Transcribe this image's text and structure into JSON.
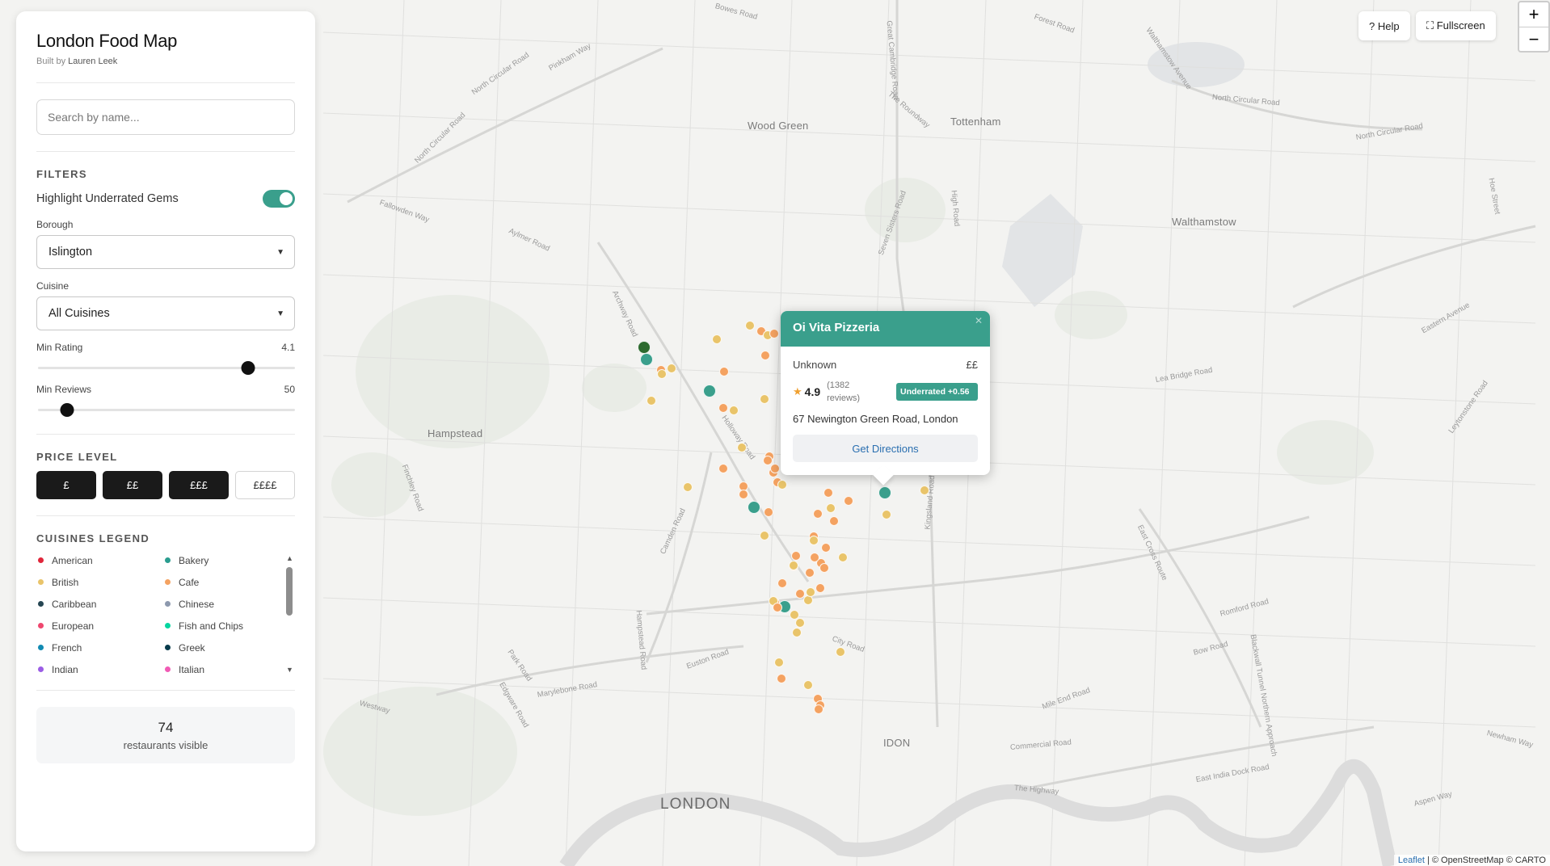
{
  "app": {
    "title": "London Food Map",
    "byline_prefix": "Built by",
    "byline_author": "Lauren Leek"
  },
  "search": {
    "placeholder": "Search by name..."
  },
  "filters": {
    "heading": "FILTERS",
    "highlight_label": "Highlight Underrated Gems",
    "highlight_on": true,
    "borough_label": "Borough",
    "borough_value": "Islington",
    "cuisine_label": "Cuisine",
    "cuisine_value": "All Cuisines",
    "min_rating_label": "Min Rating",
    "min_rating_value": "4.1",
    "min_reviews_label": "Min Reviews",
    "min_reviews_value": "50"
  },
  "price": {
    "heading": "PRICE LEVEL",
    "options": [
      {
        "label": "£",
        "selected": true
      },
      {
        "label": "££",
        "selected": true
      },
      {
        "label": "£££",
        "selected": true
      },
      {
        "label": "££££",
        "selected": false
      }
    ]
  },
  "legend": {
    "heading": "CUISINES LEGEND",
    "items": [
      {
        "label": "American",
        "color": "#e0263a"
      },
      {
        "label": "Bakery",
        "color": "#2a9d8f"
      },
      {
        "label": "British",
        "color": "#e9c46a"
      },
      {
        "label": "Cafe",
        "color": "#f4a261"
      },
      {
        "label": "Caribbean",
        "color": "#264653"
      },
      {
        "label": "Chinese",
        "color": "#8d99ae"
      },
      {
        "label": "European",
        "color": "#ef476f"
      },
      {
        "label": "Fish and Chips",
        "color": "#06d6a0"
      },
      {
        "label": "French",
        "color": "#118ab2"
      },
      {
        "label": "Greek",
        "color": "#073b4c"
      },
      {
        "label": "Indian",
        "color": "#9b5de5"
      },
      {
        "label": "Italian",
        "color": "#f15bb5"
      }
    ]
  },
  "count": {
    "value": "74",
    "label": "restaurants visible"
  },
  "controls": {
    "help": "? Help",
    "fullscreen": "⛶ Fullscreen",
    "zoom_in": "+",
    "zoom_out": "−"
  },
  "map": {
    "places": [
      "Wood Green",
      "Tottenham",
      "Walthamstow",
      "Hampstead",
      "IDON",
      "LONDON"
    ],
    "roads": [
      "Bowes Road",
      "North Circular Road",
      "Pinkham Way",
      "Great Cambridge Road",
      "The Roundway",
      "Walthamstow Avenue",
      "North Circular Road",
      "North Circular Road",
      "High Road",
      "Forest Road",
      "North Circular Road",
      "Seven Sisters Road",
      "Aylmer Road",
      "Fallowden Way",
      "Archway Road",
      "Holloway Road",
      "Camden Road",
      "Hampstead Road",
      "Euston Road",
      "Marylebone Road",
      "Edgware Road",
      "Park Road",
      "Westway",
      "Finchley Road",
      "Hoe Street",
      "Eastern Avenue",
      "Lea Bridge Road",
      "East Cross Route",
      "Kingsland Road",
      "City Road",
      "Mile End Road",
      "Commercial Road",
      "The Highway",
      "Bow Road",
      "Romford Road",
      "Newham Way",
      "East India Dock Road",
      "Aspen Way",
      "Leytonstone Road",
      "Blackwall Tunnel Northern Approach"
    ]
  },
  "popup": {
    "name": "Oi Vita Pizzeria",
    "cuisine": "Unknown",
    "price": "££",
    "rating": "4.9",
    "reviews": "(1382 reviews)",
    "badge": "Underrated +0.56",
    "address": "67 Newington Green Road, London",
    "button": "Get Directions"
  },
  "attribution": {
    "leaflet": "Leaflet",
    "rest": "| © OpenStreetMap © CARTO"
  },
  "markers": {
    "cafe_color": "#f4a261",
    "british_color": "#e9c46a",
    "bakery_color": "#3a9f8c",
    "dark_green": "#2d6a2f",
    "gem_count": 6
  }
}
